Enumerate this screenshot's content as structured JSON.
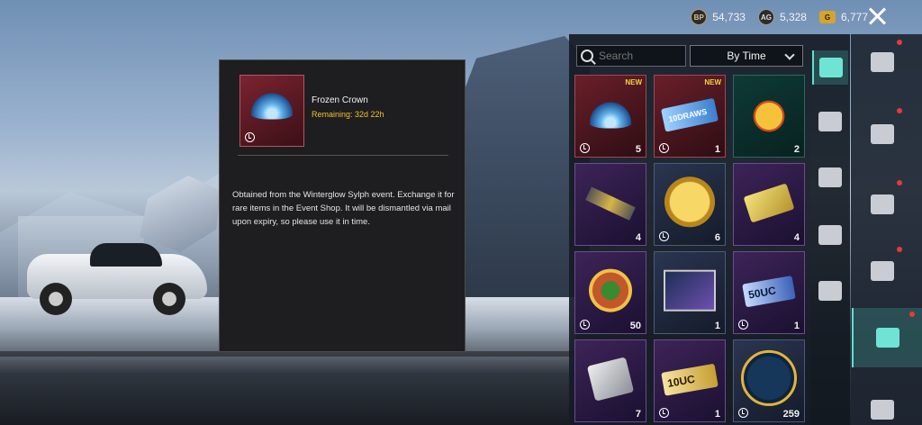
{
  "topbar": {
    "currencies": [
      {
        "icon": "bp-coin-icon",
        "symbol": "BP",
        "value": "54,733"
      },
      {
        "icon": "ag-coin-icon",
        "symbol": "AG",
        "value": "5,328"
      },
      {
        "icon": "g-coin-icon",
        "symbol": "G",
        "value": "6,777"
      }
    ]
  },
  "detail": {
    "item_name": "Frozen Crown",
    "remaining": "Remaining: 32d 22h",
    "description": "Obtained from the Winterglow Sylph event. Exchange it for rare items in the Event Shop. It will be dismantled via mail upon expiry, so please use it in time."
  },
  "inventory": {
    "search_placeholder": "Search",
    "sort_value": "By Time",
    "items": [
      {
        "badge": "NEW",
        "count": "5",
        "rarity": "red",
        "icon": "frozen-crown-icon",
        "timed": true
      },
      {
        "badge": "NEW",
        "count": "1",
        "rarity": "red",
        "icon": "draw-ticket-icon",
        "art_text": "10DRAWS",
        "timed": true
      },
      {
        "badge": "",
        "count": "2",
        "rarity": "gold",
        "icon": "chicken-emote-icon",
        "timed": false
      },
      {
        "badge": "",
        "count": "4",
        "rarity": "purple",
        "icon": "gun-part-icon",
        "timed": false
      },
      {
        "badge": "",
        "count": "6",
        "rarity": "blue",
        "icon": "gold-coin-icon",
        "timed": true
      },
      {
        "badge": "",
        "count": "4",
        "rarity": "purple",
        "icon": "gold-card-icon",
        "timed": false
      },
      {
        "badge": "",
        "count": "50",
        "rarity": "purple",
        "icon": "medal-icon",
        "timed": true
      },
      {
        "badge": "",
        "count": "1",
        "rarity": "blue",
        "icon": "photo-frame-icon",
        "timed": false
      },
      {
        "badge": "",
        "count": "1",
        "rarity": "purple",
        "icon": "uc-voucher-icon",
        "art_text": "50UC",
        "timed": true
      },
      {
        "badge": "",
        "count": "7",
        "rarity": "purple",
        "icon": "silver-ticket-icon",
        "timed": false
      },
      {
        "badge": "",
        "count": "1",
        "rarity": "purple",
        "icon": "uc-voucher-icon",
        "art_text": "10UC",
        "timed": true
      },
      {
        "badge": "",
        "count": "259",
        "rarity": "blue",
        "icon": "firework-rocket-icon",
        "timed": true
      }
    ]
  },
  "sidebar": {
    "primary": [
      "crate-icon",
      "sale-tag-icon",
      "rail-icon",
      "fire-icon",
      "storage-box-icon"
    ],
    "secondary": [
      "character-icon",
      "pistol-icon",
      "steering-wheel-icon",
      "armor-icon",
      "box-icon",
      "avatar-icon"
    ]
  }
}
